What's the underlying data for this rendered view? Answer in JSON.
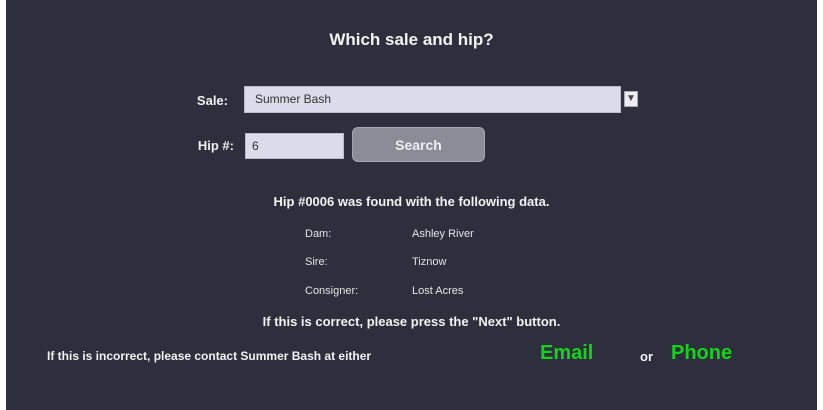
{
  "header": {
    "title": "Which sale and hip?"
  },
  "form": {
    "sale_label": "Sale:",
    "sale_value": "Summer Bash",
    "hip_label": "Hip #:",
    "hip_value": "6",
    "search_label": "Search",
    "dropdown_icon": "chevron-down-icon"
  },
  "result": {
    "found_text": "Hip #0006 was found with the following data.",
    "details": [
      {
        "key": "Dam:",
        "value": "Ashley River"
      },
      {
        "key": "Sire:",
        "value": "Tiznow"
      },
      {
        "key": "Consigner:",
        "value": "Lost Acres"
      }
    ]
  },
  "footer": {
    "confirm_text": "If this is correct, please press the \"Next\" button.",
    "contact_text": "If this is incorrect, please contact Summer Bash at either",
    "email_label": "Email",
    "or_text": "or",
    "phone_label": "Phone",
    "link_color": "#17d11d"
  }
}
